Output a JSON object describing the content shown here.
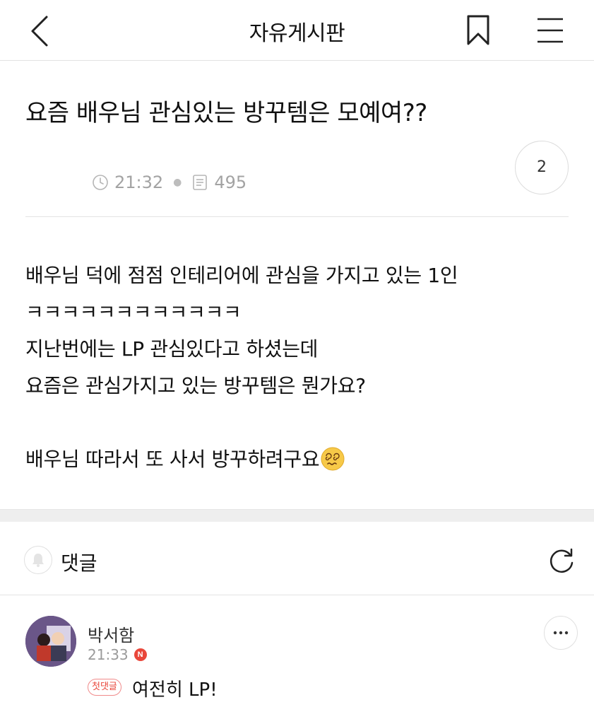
{
  "header": {
    "title": "자유게시판",
    "back_icon": "chevron-left-icon",
    "bookmark_icon": "bookmark-icon",
    "menu_icon": "hamburger-menu-icon"
  },
  "post": {
    "title": "요즘 배우님 관심있는 방꾸템은 모예여??",
    "time": "21:32",
    "views": "495",
    "comment_count": "2",
    "body_lines": [
      "배우님 덕에 점점 인테리어에 관심을 가지고 있는 1인",
      "ㅋㅋㅋㅋㅋㅋㅋㅋㅋㅋㅋㅋ",
      "지난번에는 LP 관심있다고 하셨는데",
      "요즘은 관심가지고 있는 방꾸템은 뭔가요?",
      "",
      "배우님 따라서 또 사서 방꾸하려구요"
    ],
    "emoji": "dizzy-face-emoji"
  },
  "comments": {
    "label": "댓글",
    "bell_icon": "bell-icon",
    "refresh_icon": "refresh-icon",
    "items": [
      {
        "author": "박서함",
        "time": "21:33",
        "new_badge": "N",
        "tag": "첫댓글",
        "text": "여전히 LP!"
      }
    ]
  },
  "colors": {
    "accent_red": "#e9473b",
    "divider": "#e3e3e3",
    "muted_text": "#a3a3a3"
  }
}
